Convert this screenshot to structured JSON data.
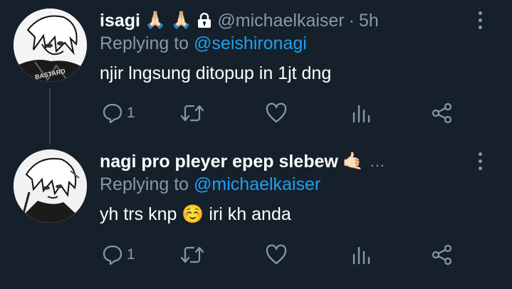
{
  "tweets": [
    {
      "name": "isagi",
      "name_emoji": "🙏🏻 🙏🏻",
      "handle": "@michaelkaiser",
      "separator": "·",
      "time": "5h",
      "reply_prefix": "Replying to",
      "reply_to": "@seishironagi",
      "text": "njir lngsung ditopup in 1jt dng",
      "reply_count": "1",
      "avatar_text": "BASTARD",
      "icons": [
        "reply-icon",
        "retweet-icon",
        "like-icon",
        "stats-icon",
        "share-icon"
      ]
    },
    {
      "name": "nagi pro pleyer epep slebew",
      "name_emoji": "🤙🏻",
      "name_overflow": "…",
      "reply_prefix": "Replying to",
      "reply_to": "@michaelkaiser",
      "text_before": "yh trs knp",
      "text_emoji": "☺️",
      "text_after": "iri kh anda",
      "reply_count": "1",
      "icons": [
        "reply-icon",
        "retweet-icon",
        "like-icon",
        "stats-icon",
        "share-icon"
      ]
    }
  ],
  "colors": {
    "background": "#15202b",
    "primary_text": "#ffffff",
    "secondary_text": "#8899a6",
    "mention": "#1da1f2",
    "thread_line": "#38444d"
  }
}
